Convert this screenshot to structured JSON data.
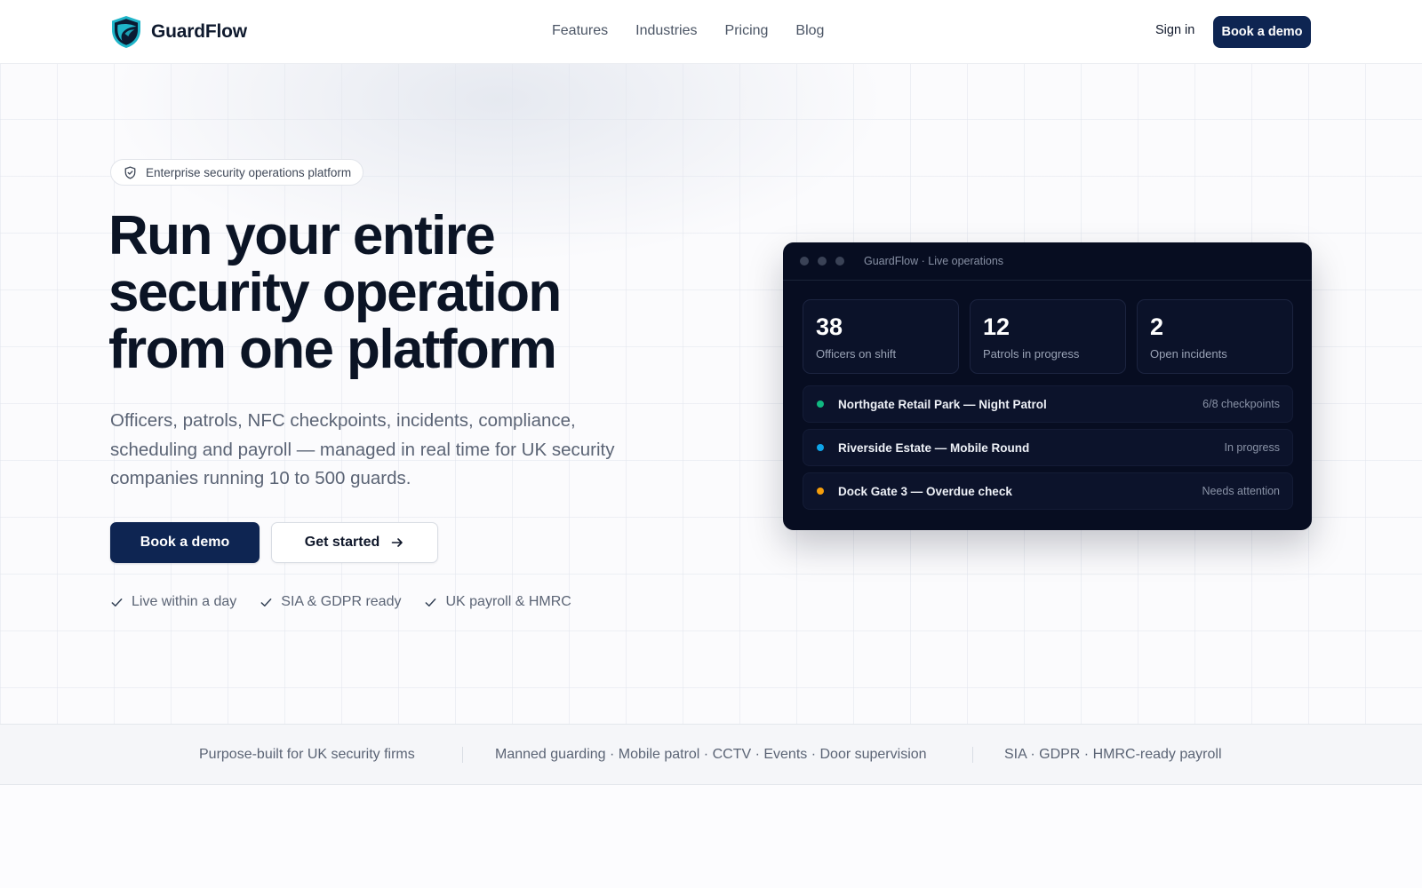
{
  "brand": {
    "name": "GuardFlow"
  },
  "nav": {
    "items": [
      {
        "label": "Features"
      },
      {
        "label": "Industries"
      },
      {
        "label": "Pricing"
      },
      {
        "label": "Blog"
      }
    ],
    "sign_in": "Sign in",
    "book_demo": "Book a demo"
  },
  "hero": {
    "badge": "Enterprise security operations platform",
    "headline": [
      "Run your entire",
      "security operation",
      "from one platform"
    ],
    "subtitle": "Officers, patrols, NFC checkpoints, incidents, compliance, scheduling and payroll — managed in real time for UK security companies running 10 to 500 guards.",
    "primary_cta": "Book a demo",
    "secondary_cta": "Get started",
    "checks": [
      {
        "label": "Live within a day"
      },
      {
        "label": "SIA & GDPR ready"
      },
      {
        "label": "UK payroll & HMRC"
      }
    ]
  },
  "dashboard": {
    "title": "GuardFlow · Live operations",
    "stats": [
      {
        "value": "38",
        "label": "Officers on shift"
      },
      {
        "value": "12",
        "label": "Patrols in progress"
      },
      {
        "value": "2",
        "label": "Open incidents"
      }
    ],
    "rows": [
      {
        "title": "Northgate Retail Park — Night Patrol",
        "status": "6/8 checkpoints",
        "color": "#10b981"
      },
      {
        "title": "Riverside Estate — Mobile Round",
        "status": "In progress",
        "color": "#0ea5e9"
      },
      {
        "title": "Dock Gate 3 — Overdue check",
        "status": "Needs attention",
        "color": "#f59e0b"
      }
    ]
  },
  "strip": {
    "items": [
      "Purpose-built for UK security firms",
      "Manned guarding · Mobile patrol · CCTV · Events · Door supervision",
      "SIA · GDPR · HMRC-ready payroll"
    ]
  },
  "colors": {
    "brand_navy": "#0e2552",
    "panel_bg": "#070d21",
    "logo_teal": "#1fb5c9"
  },
  "icons": {
    "logo": "shield-logo-icon",
    "badge": "shield-check-icon",
    "cta_arrow": "arrow-right-icon",
    "checks": "check-icon"
  }
}
